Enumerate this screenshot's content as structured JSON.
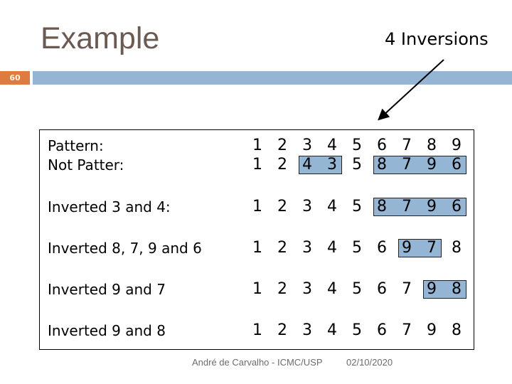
{
  "slide": {
    "title": "Example",
    "number": "60",
    "callout": "4 Inversions",
    "footer_author": "André de Carvalho - ICMC/USP",
    "footer_date": "02/10/2020"
  },
  "rows": [
    {
      "label": "Pattern:",
      "digits": [
        "1",
        "2",
        "3",
        "4",
        "5",
        "6",
        "7",
        "8",
        "9"
      ],
      "highlights": []
    },
    {
      "label": "Not Patter:",
      "digits": [
        "1",
        "2",
        "4",
        "3",
        "5",
        "8",
        "7",
        "9",
        "6"
      ],
      "highlights": [
        [
          2,
          3
        ],
        [
          5,
          8
        ]
      ]
    },
    {
      "label": "Inverted 3 and 4:",
      "digits": [
        "1",
        "2",
        "3",
        "4",
        "5",
        "8",
        "7",
        "9",
        "6"
      ],
      "highlights": [
        [
          5,
          8
        ]
      ]
    },
    {
      "label": "Inverted 8, 7, 9 and 6",
      "digits": [
        "1",
        "2",
        "3",
        "4",
        "5",
        "6",
        "9",
        "7",
        "8"
      ],
      "highlights": [
        [
          6,
          7
        ]
      ]
    },
    {
      "label": "Inverted 9 and 7",
      "digits": [
        "1",
        "2",
        "3",
        "4",
        "5",
        "6",
        "7",
        "9",
        "8"
      ],
      "highlights": [
        [
          7,
          8
        ]
      ]
    },
    {
      "label": "Inverted 9 and 8",
      "digits": [
        "1",
        "2",
        "3",
        "4",
        "5",
        "6",
        "7",
        "9",
        "8"
      ],
      "highlights": []
    }
  ],
  "colors": {
    "accent_orange": "#e07b3f",
    "accent_blue": "#94b5d4",
    "title_color": "#6b5a52"
  }
}
